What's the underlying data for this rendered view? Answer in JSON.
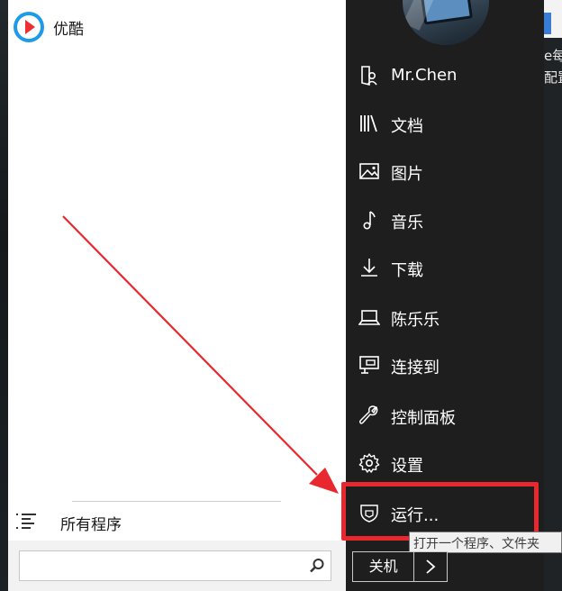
{
  "start_menu": {
    "pinned_app": {
      "label": "优酷",
      "icon": "youku-logo-icon"
    },
    "all_programs": {
      "label": "所有程序",
      "icon": "list-icon"
    },
    "search": {
      "value": "",
      "placeholder": ""
    }
  },
  "right_pane": {
    "user": {
      "label": "Mr.Chen",
      "icon": "user-folder-icon"
    },
    "items": [
      {
        "label": "文档",
        "icon": "library-icon"
      },
      {
        "label": "图片",
        "icon": "picture-icon"
      },
      {
        "label": "音乐",
        "icon": "music-note-icon"
      },
      {
        "label": "下载",
        "icon": "download-icon"
      },
      {
        "label": "陈乐乐",
        "icon": "laptop-icon"
      },
      {
        "label": "连接到",
        "icon": "network-icon"
      },
      {
        "label": "控制面板",
        "icon": "wrench-icon"
      },
      {
        "label": "设置",
        "icon": "gear-icon"
      },
      {
        "label": "运行...",
        "icon": "run-icon"
      }
    ],
    "tooltip": "打开一个程序、文件夹",
    "shutdown": {
      "label": "关机",
      "icon": "chevron-right-icon"
    }
  },
  "background": {
    "text_lines": [
      "e每",
      "配置"
    ]
  },
  "colors": {
    "highlight": "#e8282e",
    "arrow": "#e8282e",
    "youku_red": "#ef2f2f",
    "youku_blue": "#1e9be8"
  }
}
